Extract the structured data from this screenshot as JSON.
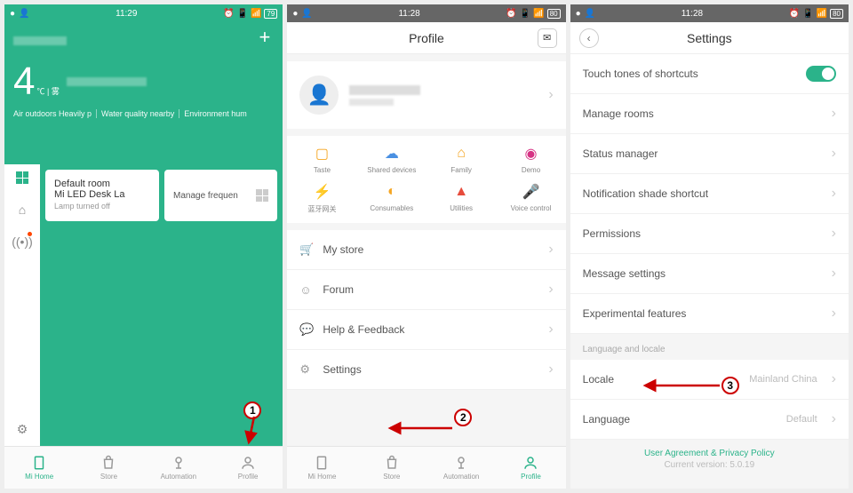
{
  "status": {
    "time1": "11:29",
    "time2": "11:28",
    "batt1": "79",
    "batt2": "80"
  },
  "s1": {
    "temp": "4",
    "unit": "℃",
    "cond": "雾",
    "info1": "Air outdoors Heavily p",
    "info2": "Water quality nearby",
    "info3": "Environment hum",
    "card1_title": "Default room",
    "card1_sub": "Mi LED Desk La",
    "card1_sub2": "Lamp turned off",
    "card2_title": "Manage frequen"
  },
  "nav": {
    "home": "Mi Home",
    "store": "Store",
    "auto": "Automation",
    "profile": "Profile"
  },
  "s2": {
    "title": "Profile",
    "grid": [
      {
        "label": "Taste",
        "color": "#f5a623"
      },
      {
        "label": "Shared devices",
        "color": "#4a90e2"
      },
      {
        "label": "Family",
        "color": "#f5a623"
      },
      {
        "label": "Demo",
        "color": "#d63384"
      },
      {
        "label": "蓝牙网关",
        "color": "#4a90e2"
      },
      {
        "label": "Consumables",
        "color": "#f5a623"
      },
      {
        "label": "Utilities",
        "color": "#e74c3c"
      },
      {
        "label": "Voice control",
        "color": "#aaa"
      }
    ],
    "items": [
      {
        "icon": "🛒",
        "label": "My store"
      },
      {
        "icon": "☺",
        "label": "Forum"
      },
      {
        "icon": "💬",
        "label": "Help & Feedback"
      },
      {
        "icon": "⚙",
        "label": "Settings"
      }
    ]
  },
  "s3": {
    "title": "Settings",
    "items1": [
      {
        "label": "Touch tones of shortcuts",
        "toggle": true
      },
      {
        "label": "Manage rooms"
      },
      {
        "label": "Status manager"
      },
      {
        "label": "Notification shade shortcut"
      },
      {
        "label": "Permissions"
      },
      {
        "label": "Message settings"
      },
      {
        "label": "Experimental features"
      }
    ],
    "section": "Language and locale",
    "items2": [
      {
        "label": "Locale",
        "value": "Mainland China"
      },
      {
        "label": "Language",
        "value": "Default"
      }
    ],
    "footer_link": "User Agreement & Privacy Policy",
    "footer_ver": "Current version: 5.0.19"
  },
  "anno": {
    "n1": "1",
    "n2": "2",
    "n3": "3"
  }
}
